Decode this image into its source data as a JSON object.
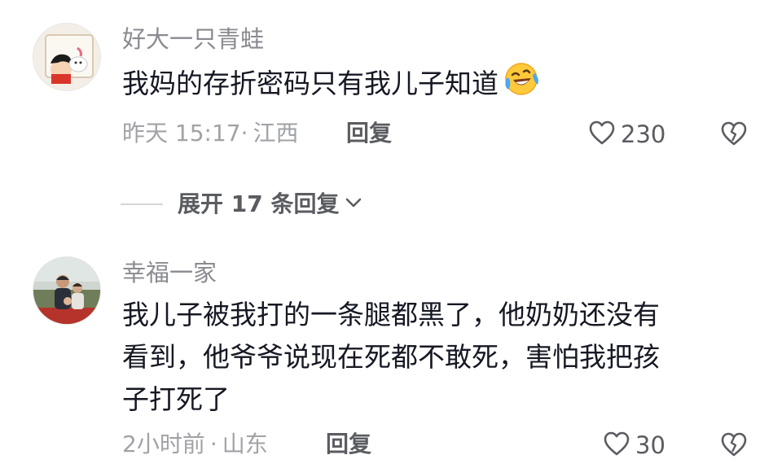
{
  "comments": [
    {
      "username": "好大一只青蛙",
      "text_lines": [
        "我妈的存折密码只有我儿子知道"
      ],
      "emoji": "laughing-crying-emoji",
      "time": "昨天 15:17",
      "separator": "·",
      "location": "江西",
      "reply_label": "回复",
      "likes": "230"
    },
    {
      "username": "幸福一家",
      "text_lines": [
        "我儿子被我打的一条腿都黑了，他奶奶还没有",
        "看到，他爷爷说现在死都不敢死，害怕我把孩",
        "子打死了"
      ],
      "time": "2小时前",
      "separator": "·",
      "location": "山东",
      "reply_label": "回复",
      "likes": "30"
    }
  ],
  "expand_replies": {
    "label": "展开 17 条回复"
  },
  "icons": {
    "like": "heart-outline-icon",
    "dislike": "broken-heart-icon",
    "expand": "chevron-down-icon"
  },
  "colors": {
    "username": "#8a8b91",
    "meta": "#a1a2a7",
    "text": "#161823",
    "action": "#5b5c61"
  }
}
